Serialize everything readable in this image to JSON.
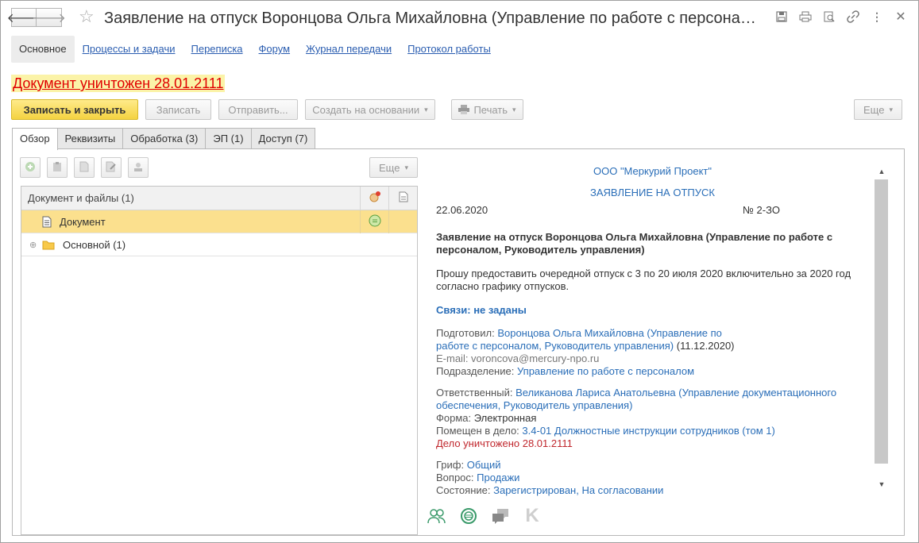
{
  "window": {
    "title": "Заявление на отпуск Воронцова Ольга Михайловна (Управление по работе с персоналом, Р..."
  },
  "sections": [
    {
      "label": "Основное"
    },
    {
      "label": "Процессы и задачи"
    },
    {
      "label": "Переписка"
    },
    {
      "label": "Форум"
    },
    {
      "label": "Журнал передачи"
    },
    {
      "label": "Протокол работы"
    }
  ],
  "status_banner": "Документ уничтожен 28.01.2111",
  "toolbar": {
    "save_close": "Записать и закрыть",
    "save": "Записать",
    "send": "Отправить...",
    "create_based": "Создать на основании",
    "print": "Печать",
    "more": "Еще"
  },
  "tabs": [
    {
      "label": "Обзор"
    },
    {
      "label": "Реквизиты"
    },
    {
      "label": "Обработка (3)"
    },
    {
      "label": "ЭП (1)"
    },
    {
      "label": "Доступ (7)"
    }
  ],
  "files": {
    "more": "Еще",
    "header": "Документ и файлы (1)",
    "rows": [
      {
        "name": "Документ"
      },
      {
        "name": "Основной (1)"
      }
    ]
  },
  "document": {
    "org": "ООО \"Меркурий Проект\"",
    "doc_title": "ЗАЯВЛЕНИЕ НА ОТПУСК",
    "date": "22.06.2020",
    "number": "№ 2-ЗО",
    "subject": "Заявление на отпуск Воронцова Ольга Михайловна (Управление по работе с персоналом, Руководитель управления)",
    "body": "Прошу предоставить очередной отпуск с 3 по 20 июля 2020 включительно за 2020 год согласно графику отпусков.",
    "links": "Связи: не заданы",
    "prepared_label": "Подготовил:",
    "prepared_value_1": "Воронцова Ольга Михайловна (Управление по",
    "prepared_value_2": "работе с персоналом, Руководитель управления)",
    "prepared_date": "(11.12.2020)",
    "email": "E-mail: voroncova@mercury-npo.ru",
    "dept_label": "Подразделение:",
    "dept_value": "Управление по работе с персоналом",
    "resp_label": "Ответственный:",
    "resp_value_1": "Великанова Лариса Анатольевна (Управление документационного",
    "resp_value_2": "обеспечения, Руководитель управления)",
    "form_label": "Форма:",
    "form_value": "Электронная",
    "case_label": "Помещен в дело:",
    "case_value": "3.4-01 Должностные инструкции сотрудников (том 1)",
    "case_destroyed": "Дело уничтожено 28.01.2111",
    "grif_label": "Гриф:",
    "grif_value": "Общий",
    "question_label": "Вопрос:",
    "question_value": "Продажи",
    "state_label": "Состояние:",
    "state_value": "Зарегистрирован, На согласовании"
  },
  "colors": {
    "accent_link": "#2a6eb8",
    "primary_button": "#f4d341",
    "selected_row": "#fbe08e",
    "banner_text": "#e00000",
    "banner_bg": "#fbf3a8"
  }
}
